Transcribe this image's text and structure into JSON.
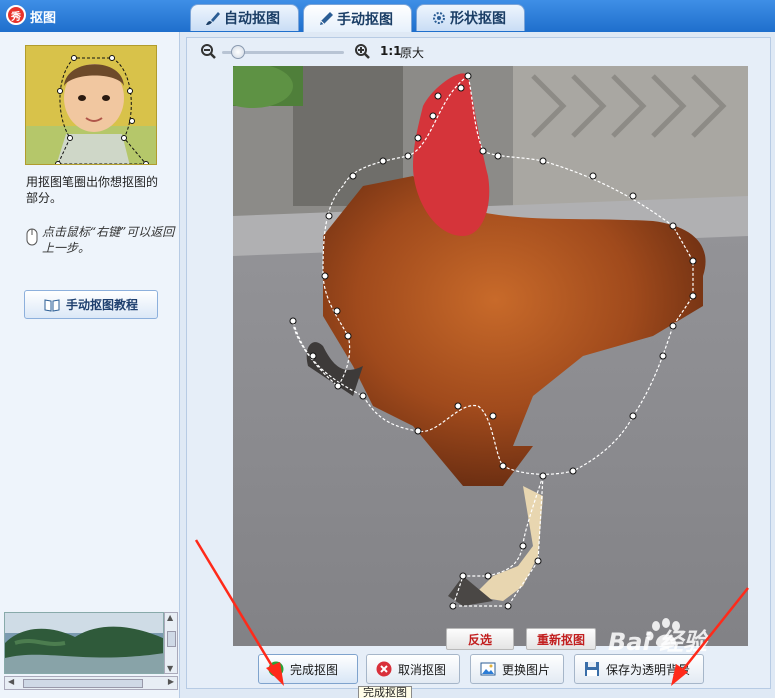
{
  "app": {
    "title": "抠图",
    "badge": "秀"
  },
  "tabs": [
    {
      "label": "自动抠图",
      "icon": "brush-icon"
    },
    {
      "label": "手动抠图",
      "icon": "pen-icon"
    },
    {
      "label": "形状抠图",
      "icon": "gear-shape-icon"
    }
  ],
  "left": {
    "hint": "用抠图笔圈出你想抠图的部分。",
    "mouse_hint": "点击鼠标“右键”可以返回上一步。",
    "tutorial_label": "手动抠图教程"
  },
  "zoom": {
    "ratio": "1:1",
    "original_label": "原大",
    "slider_level": 0.08
  },
  "canvas_buttons": {
    "invert": "反选",
    "redo": "重新抠图"
  },
  "actions": {
    "finish": "完成抠图",
    "cancel": "取消抠图",
    "replace": "更换图片",
    "save_transparent": "保存为透明背景"
  },
  "tooltip": "完成抠图",
  "watermark": "Bai 经验",
  "colors": {
    "titlebar": "#2b7cd6",
    "accent_red": "#c21f1f",
    "annotation_red": "#ff2a1a"
  }
}
